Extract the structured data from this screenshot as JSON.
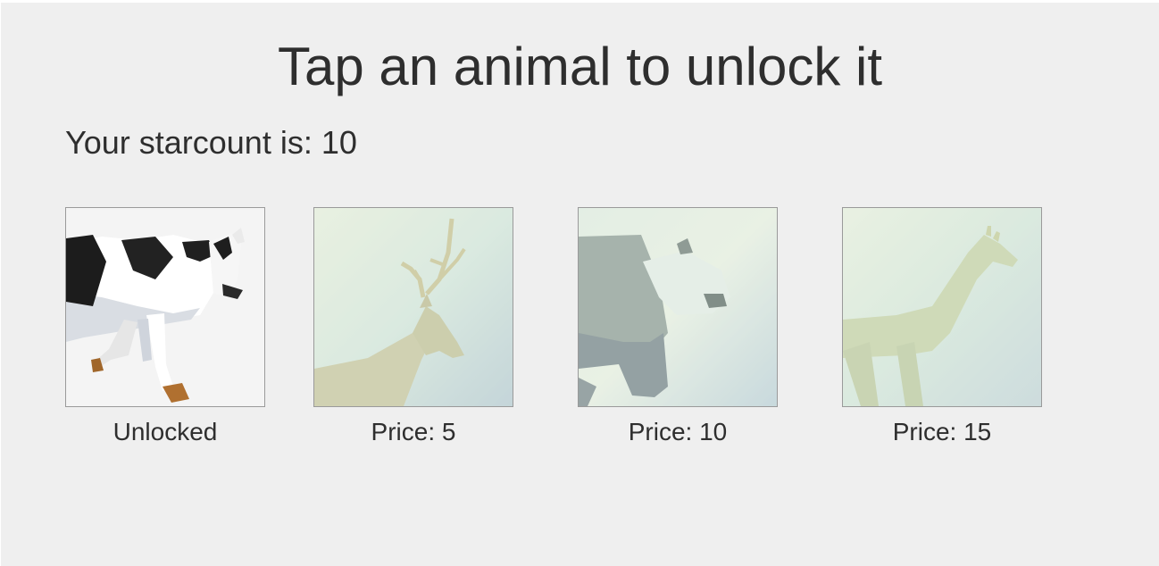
{
  "title": "Tap an animal to unlock it",
  "starcount": "Your starcount is: 10",
  "animals": [
    {
      "name": "cow",
      "status": "Unlocked",
      "locked": false
    },
    {
      "name": "deer",
      "status": "Price: 5",
      "locked": true
    },
    {
      "name": "panda",
      "status": "Price: 10",
      "locked": true
    },
    {
      "name": "giraffe",
      "status": "Price: 15",
      "locked": true
    }
  ],
  "colors": {
    "background": "#efefef",
    "text": "#2e2e2e",
    "locked_overlay": "#dfeee0"
  }
}
